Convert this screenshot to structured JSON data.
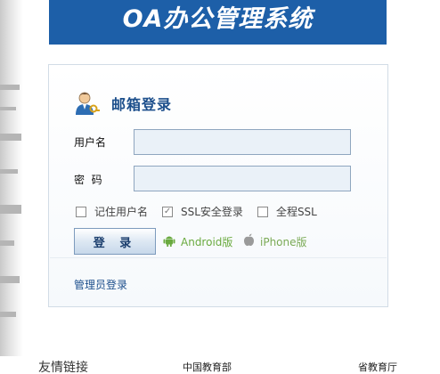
{
  "banner": {
    "title": "OA办公管理系统"
  },
  "login": {
    "title": "邮箱登录",
    "username_label": "用户名",
    "password_label": "密  码",
    "username_value": "",
    "password_value": "",
    "options": [
      {
        "label": "记住用户名",
        "checked": false
      },
      {
        "label": "SSL安全登录",
        "checked": true
      },
      {
        "label": "全程SSL",
        "checked": false
      }
    ],
    "submit_label": "登 录",
    "android_label": "Android版",
    "iphone_label": "iPhone版",
    "admin_label": "管理员登录"
  },
  "footer": {
    "title": "友情链接",
    "links": [
      "中国教育部",
      "省教育厅"
    ]
  },
  "colors": {
    "banner": "#1d5fa8",
    "title": "#1d4f8c",
    "android": "#6aaa3f"
  }
}
